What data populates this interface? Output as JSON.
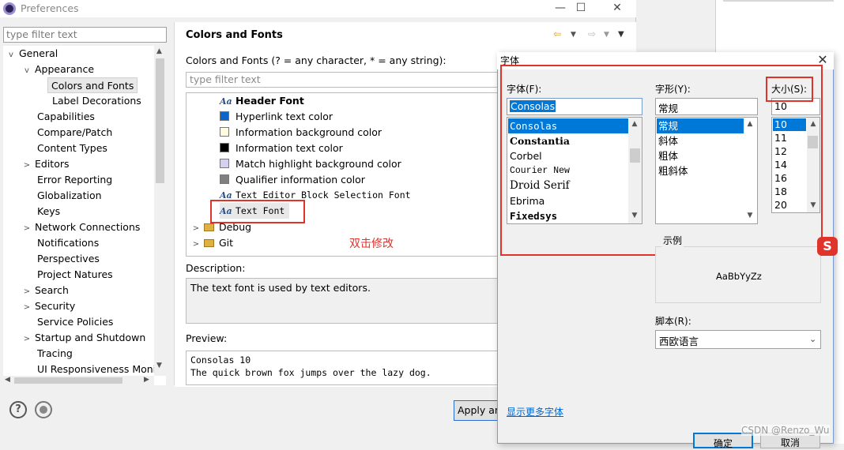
{
  "window": {
    "title": "Preferences",
    "minimize": "—",
    "maximize": "☐",
    "close": "✕"
  },
  "filter_left": {
    "placeholder": "type filter text"
  },
  "tree": [
    {
      "label": "General",
      "twisty": "v"
    },
    {
      "label": "Appearance",
      "twisty": "v"
    },
    {
      "label": "Colors and Fonts",
      "twisty": ""
    },
    {
      "label": "Label Decorations",
      "twisty": ""
    },
    {
      "label": "Capabilities",
      "twisty": ""
    },
    {
      "label": "Compare/Patch",
      "twisty": ""
    },
    {
      "label": "Content Types",
      "twisty": ""
    },
    {
      "label": "Editors",
      "twisty": ">"
    },
    {
      "label": "Error Reporting",
      "twisty": ""
    },
    {
      "label": "Globalization",
      "twisty": ""
    },
    {
      "label": "Keys",
      "twisty": ""
    },
    {
      "label": "Network Connections",
      "twisty": ">"
    },
    {
      "label": "Notifications",
      "twisty": ""
    },
    {
      "label": "Perspectives",
      "twisty": ""
    },
    {
      "label": "Project Natures",
      "twisty": ""
    },
    {
      "label": "Search",
      "twisty": ">"
    },
    {
      "label": "Security",
      "twisty": ">"
    },
    {
      "label": "Service Policies",
      "twisty": ""
    },
    {
      "label": "Startup and Shutdown",
      "twisty": ">"
    },
    {
      "label": "Tracing",
      "twisty": ""
    },
    {
      "label": "UI Responsiveness Monit",
      "twisty": ""
    }
  ],
  "main": {
    "title": "Colors and Fonts",
    "pattern_label": "Colors and Fonts (? = any character, * = any string):",
    "filter_placeholder": "type filter text",
    "items": [
      {
        "label": "Header Font",
        "kind": "font",
        "bold": true
      },
      {
        "label": "Hyperlink text color",
        "kind": "color",
        "color": "#0b64c9"
      },
      {
        "label": "Information background color",
        "kind": "color",
        "color": "#fffce0"
      },
      {
        "label": "Information text color",
        "kind": "color",
        "color": "#000000"
      },
      {
        "label": "Match highlight background color",
        "kind": "color",
        "color": "#d6d0f0"
      },
      {
        "label": "Qualifier information color",
        "kind": "color",
        "color": "#808080"
      },
      {
        "label": "Text Editor Block Selection Font",
        "kind": "font-mono"
      },
      {
        "label": "Text Font",
        "kind": "font-mono"
      }
    ],
    "categories": [
      {
        "label": "Debug",
        "twisty": ">"
      },
      {
        "label": "Git",
        "twisty": ">"
      }
    ],
    "annotation": "双击修改",
    "description_label": "Description:",
    "description": "The text font is used by text editors.",
    "preview_label": "Preview:",
    "preview_line1": "Consolas 10",
    "preview_line2": "The quick brown fox jumps over the lazy dog.",
    "apply_label": "Apply and Close"
  },
  "font_dialog": {
    "title": "字体",
    "close": "✕",
    "font_label": "字体(F):",
    "font_value": "Consolas",
    "fonts": [
      "Consolas",
      "Constantia",
      "Corbel",
      "Courier New",
      "Droid Serif",
      "Ebrima",
      "Fixedsys"
    ],
    "style_label": "字形(Y):",
    "style_value": "常规",
    "styles": [
      "常规",
      "斜体",
      "粗体",
      "粗斜体"
    ],
    "size_label": "大小(S):",
    "size_value": "10",
    "sizes": [
      "10",
      "11",
      "12",
      "14",
      "16",
      "18",
      "20"
    ],
    "sample_label": "示例",
    "sample_text": "AaBbYyZz",
    "script_label": "脚本(R):",
    "script_value": "西欧语言",
    "more_fonts": "显示更多字体",
    "ok": "确定",
    "cancel": "取消"
  },
  "watermark": "CSDN @Renzo_Wu",
  "colors": {
    "accent": "#0078d7",
    "highlight_red": "#e0332c",
    "link": "#0066cc"
  }
}
